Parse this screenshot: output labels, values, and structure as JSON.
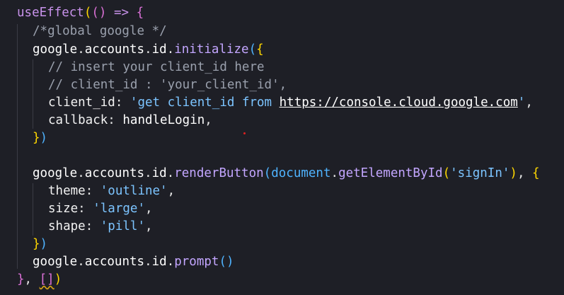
{
  "code": {
    "line1": {
      "fn": "useEffect",
      "open": "((",
      "close_args": ")",
      "arrow": " => ",
      "brace": "{"
    },
    "line2": {
      "comment": "/*global google */"
    },
    "line3": {
      "obj": "google",
      "d1": ".",
      "accounts": "accounts",
      "d2": ".",
      "id": "id",
      "d3": ".",
      "method": "initialize",
      "paren": "(",
      "brace": "{"
    },
    "line4": {
      "comment": "// insert your client_id here"
    },
    "line5": {
      "comment": "// client_id : 'your_client_id',"
    },
    "line6": {
      "key": "client_id",
      "colon": ": ",
      "str_open": "'get client_id from ",
      "url": "https://console.cloud.google.com",
      "str_close": "'",
      "comma": ","
    },
    "line7": {
      "key": "callback",
      "colon": ": ",
      "value": "handleLogin",
      "comma": ","
    },
    "line8": {
      "brace": "}",
      "paren": ")"
    },
    "line10": {
      "obj": "google",
      "d1": ".",
      "accounts": "accounts",
      "d2": ".",
      "id": "id",
      "d3": ".",
      "method": "renderButton",
      "paren": "(",
      "doc": "document",
      "d4": ".",
      "getter": "getElementById",
      "paren2": "(",
      "arg": "'signIn'",
      "paren2_close": ")",
      "comma": ", ",
      "brace": "{"
    },
    "line11": {
      "key": "theme",
      "colon": ": ",
      "value": "'outline'",
      "comma": ","
    },
    "line12": {
      "key": "size",
      "colon": ": ",
      "value": "'large'",
      "comma": ","
    },
    "line13": {
      "key": "shape",
      "colon": ": ",
      "value": "'pill'",
      "comma": ","
    },
    "line14": {
      "brace": "}",
      "paren": ")"
    },
    "line15": {
      "obj": "google",
      "d1": ".",
      "accounts": "accounts",
      "d2": ".",
      "id": "id",
      "d3": ".",
      "method": "prompt",
      "parens": "()"
    },
    "line16": {
      "brace": "}",
      "comma": ", ",
      "deps": "[]",
      "paren": ")"
    }
  }
}
